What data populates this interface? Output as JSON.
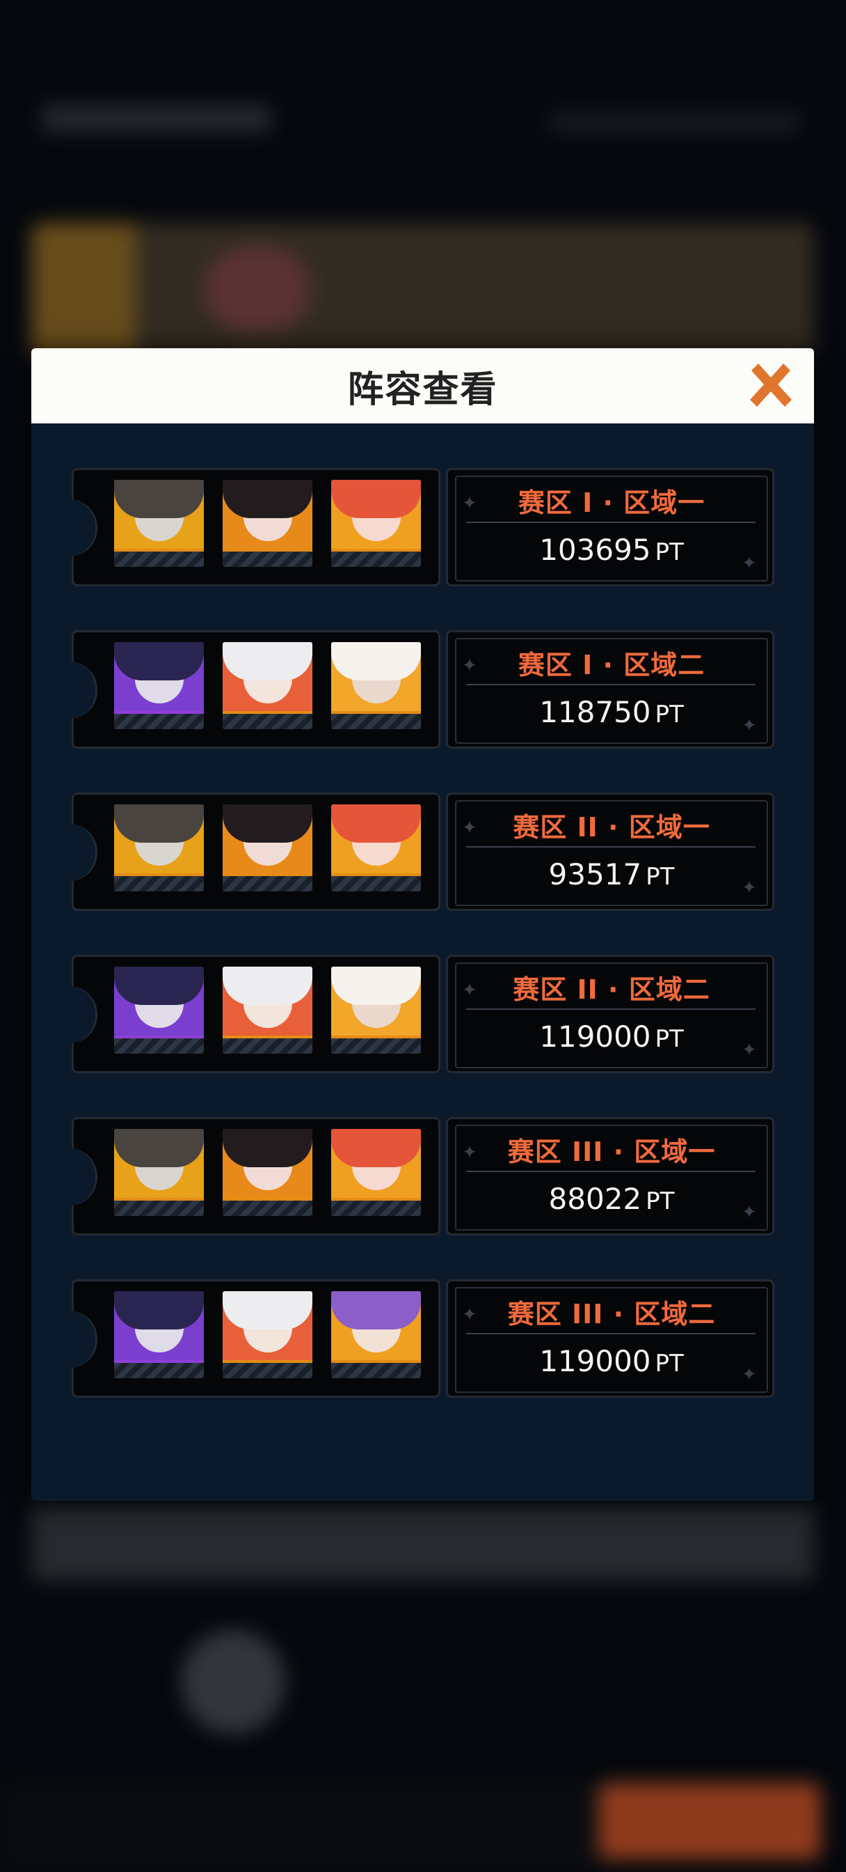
{
  "dialog": {
    "title": "阵容查看",
    "close_icon": "close-x-icon",
    "accent_color": "#f06a3d"
  },
  "lineups": [
    {
      "zone": "赛区 I · 区域一",
      "points": "103695",
      "unit": "PT",
      "characters": [
        {
          "icon": "character-portrait-beret-green-hair",
          "frame": "orange"
        },
        {
          "icon": "character-portrait-black-hair",
          "frame": "orange"
        },
        {
          "icon": "character-portrait-red-hair",
          "frame": "orange"
        }
      ]
    },
    {
      "zone": "赛区 I · 区域二",
      "points": "118750",
      "unit": "PT",
      "characters": [
        {
          "icon": "character-portrait-dark-purple-hair",
          "frame": "purple"
        },
        {
          "icon": "character-portrait-white-hair",
          "frame": "orange"
        },
        {
          "icon": "character-portrait-panda",
          "frame": "orange"
        }
      ]
    },
    {
      "zone": "赛区 II · 区域一",
      "points": "93517",
      "unit": "PT",
      "characters": [
        {
          "icon": "character-portrait-beret-green-hair",
          "frame": "orange"
        },
        {
          "icon": "character-portrait-black-hair",
          "frame": "orange"
        },
        {
          "icon": "character-portrait-red-hair",
          "frame": "orange"
        }
      ]
    },
    {
      "zone": "赛区 II · 区域二",
      "points": "119000",
      "unit": "PT",
      "characters": [
        {
          "icon": "character-portrait-dark-purple-hair",
          "frame": "purple"
        },
        {
          "icon": "character-portrait-white-hair",
          "frame": "orange"
        },
        {
          "icon": "character-portrait-panda",
          "frame": "orange"
        }
      ]
    },
    {
      "zone": "赛区 III · 区域一",
      "points": "88022",
      "unit": "PT",
      "characters": [
        {
          "icon": "character-portrait-beret-green-hair",
          "frame": "orange"
        },
        {
          "icon": "character-portrait-black-hair",
          "frame": "orange"
        },
        {
          "icon": "character-portrait-red-hair",
          "frame": "orange"
        }
      ]
    },
    {
      "zone": "赛区 III · 区域二",
      "points": "119000",
      "unit": "PT",
      "characters": [
        {
          "icon": "character-portrait-dark-purple-hair",
          "frame": "purple"
        },
        {
          "icon": "character-portrait-white-hair",
          "frame": "orange"
        },
        {
          "icon": "character-portrait-witch-hat",
          "frame": "orange"
        }
      ]
    }
  ]
}
